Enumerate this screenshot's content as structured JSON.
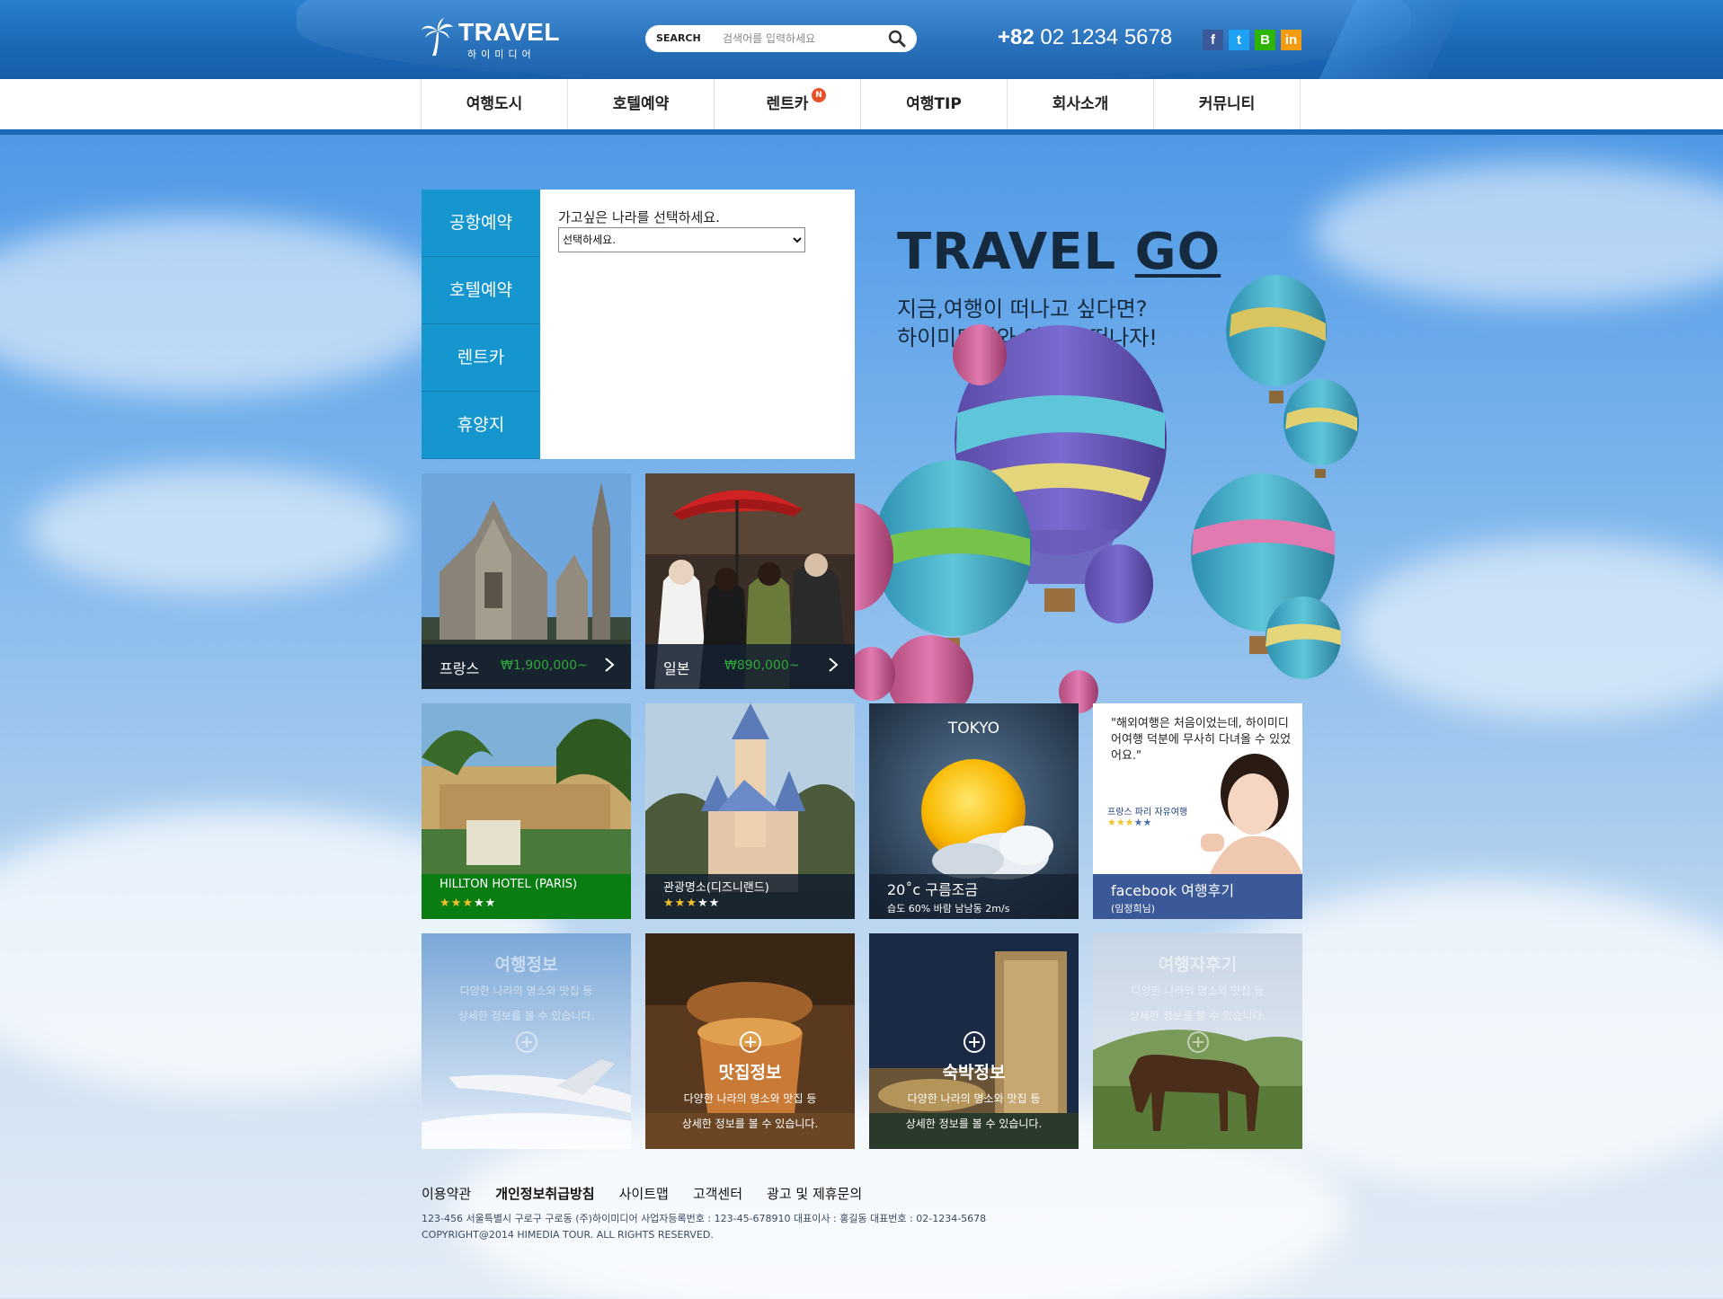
{
  "header": {
    "logo_title": "TRAVEL",
    "logo_sub": "하이미디어",
    "search_label": "SEARCH",
    "search_placeholder": "검색어를 입력하세요",
    "phone_prefix": "+82",
    "phone_number": "02 1234 5678",
    "social": [
      {
        "label": "f",
        "icon": "facebook-icon",
        "color": "#3b5998"
      },
      {
        "label": "t",
        "icon": "twitter-icon",
        "color": "#1da1f2"
      },
      {
        "label": "B",
        "icon": "blog-icon",
        "color": "#2db400"
      },
      {
        "label": "in",
        "icon": "linkedin-icon",
        "color": "#f39c12"
      }
    ]
  },
  "nav": {
    "items": [
      "여행도시",
      "호텔예약",
      "렌트카",
      "여행TIP",
      "회사소개",
      "커뮤니티"
    ],
    "badge": "N"
  },
  "booking": {
    "tabs": [
      "공항예약",
      "호텔예약",
      "렌트카",
      "휴양지"
    ],
    "label": "가고싶은 나라를 선택하세요.",
    "select_value": "선택하세요."
  },
  "hero": {
    "title_main": "TRAVEL",
    "title_go": "GO",
    "line1": "지금,여행이 떠나고 싶다면?",
    "line2": "하이미디어와 여행을 떠나자!"
  },
  "packages": [
    {
      "name": "프랑스",
      "price": "₩1,900,000~"
    },
    {
      "name": "일본",
      "price": "₩890,000~"
    }
  ],
  "info_tiles": [
    {
      "name": "HILLTON HOTEL (PARIS)",
      "rating": 3,
      "max": 5
    },
    {
      "name": "관광명소(디즈니랜드)",
      "rating": 3,
      "max": 5
    }
  ],
  "weather": {
    "city": "TOKYO",
    "condition": "20˚c 구름조금",
    "details": "습도 60% 바람 남남동 2m/s"
  },
  "review": {
    "quote": "\"해외여행은 처음이었는데, 하이미디어여행 덕분에 무사히 다녀올 수 있었어요.\"",
    "author": "프랑스 파리 자유여행",
    "rating": 3,
    "max": 5,
    "bar_title": "facebook 여행후기",
    "bar_name": "(임정희님)"
  },
  "categories": [
    {
      "title": "여행정보",
      "desc1": "다양한 나라의 명소와 맛집 등",
      "desc2": "상세한 정보를 볼 수 있습니다."
    },
    {
      "title": "맛집정보",
      "desc1": "다양한 나라의 명소와 맛집 등",
      "desc2": "상세한 정보를 볼 수 있습니다."
    },
    {
      "title": "숙박정보",
      "desc1": "다양한 나라의 명소와 맛집 등",
      "desc2": "상세한 정보를 볼 수 있습니다."
    },
    {
      "title": "여행자후기",
      "desc1": "다양한 나라의 명소와 맛집 등",
      "desc2": "상세한 정보를 볼 수 있습니다."
    }
  ],
  "footer": {
    "links": [
      "이용약관",
      "개인정보취급방침",
      "사이트맵",
      "고객센터",
      "광고 및 제휴문의"
    ],
    "address": "123-456 서울특별시 구로구 구로동 (주)하이미디어 사업자등록번호 : 123-45-678910 대표이사 : 홍길동 대표번호 : 02-1234-5678",
    "copyright": "COPYRIGHT@2014 HIMEDIA TOUR. ALL RIGHTS RESERVED."
  },
  "colors": {
    "header_blue": "#1a67b5",
    "tab_blue": "#1596cf",
    "price_green": "#2ea83a",
    "hotel_green": "#0a7d12",
    "facebook_blue": "#3b5998",
    "star_yellow": "#f3c12b"
  }
}
